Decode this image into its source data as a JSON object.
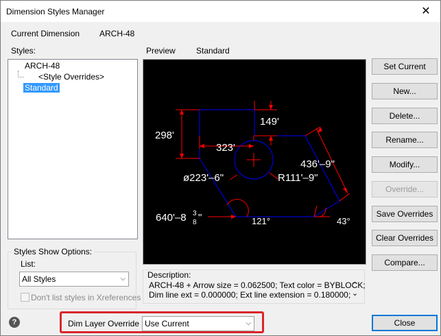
{
  "window": {
    "title": "Dimension Styles Manager",
    "close_glyph": "✕"
  },
  "current_dimension": {
    "label": "Current Dimension",
    "value": "ARCH-48"
  },
  "styles": {
    "label": "Styles:",
    "items": [
      {
        "label": "ARCH-48"
      },
      {
        "label": "<Style Overrides>"
      },
      {
        "label": "Standard",
        "selected": true
      }
    ]
  },
  "preview": {
    "label": "Preview",
    "style_name": "Standard",
    "annotations": {
      "d298": "298'",
      "d149": "149'",
      "d323": "323'",
      "d436": "436'–9\"",
      "dia": "ø223'–6\"",
      "rad": "R111'–9\"",
      "d640": "640'–8",
      "d640_num": "3",
      "d640_den": "8",
      "d640_unit": "\"",
      "d121": "121°",
      "d43": "43°"
    }
  },
  "buttons": {
    "set_current": "Set Current",
    "new": "New...",
    "delete": "Delete...",
    "rename": "Rename...",
    "modify": "Modify...",
    "override": "Override...",
    "save_overrides": "Save Overrides",
    "clear_overrides": "Clear Overrides",
    "compare": "Compare...",
    "close": "Close"
  },
  "styles_show_options": {
    "title": "Styles Show Options:",
    "list_label": "List:",
    "list_value": "All Styles",
    "xref_checkbox_label": "Don't list styles in Xreferences",
    "xref_checked": false
  },
  "description": {
    "label": "Description:",
    "line1": "ARCH-48 + Arrow size  = 0.062500; Text color = BYBLOCK;",
    "line2": "Dim line ext = 0.000000; Ext line extension = 0.180000;",
    "scroll_up": "⌃",
    "scroll_down": "⌄"
  },
  "dim_layer_override": {
    "label": "Dim Layer Override",
    "value": "Use Current"
  },
  "help_glyph": "?",
  "icons": {
    "help": "help-icon",
    "close": "close-icon",
    "dropdown": "chevron-down-icon"
  },
  "colors": {
    "accent": "#0078d7",
    "highlight": "#d9262b",
    "selection": "#3399ff",
    "preview_blue": "#0000ff",
    "preview_red": "#ff0000"
  }
}
